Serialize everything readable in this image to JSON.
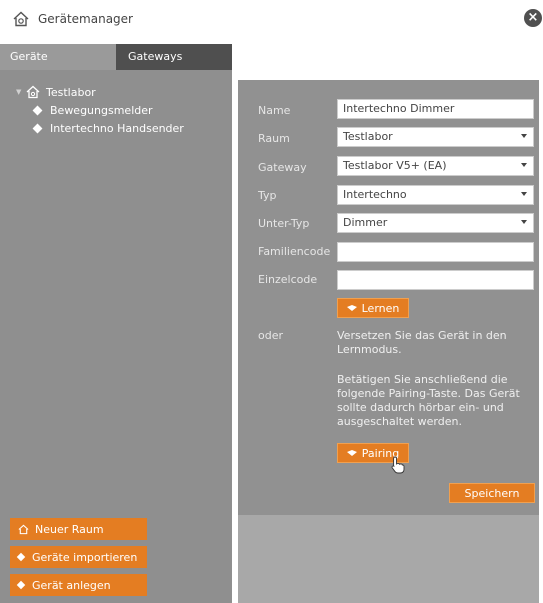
{
  "window": {
    "title": "Gerätemanager",
    "close_icon": "close-icon"
  },
  "tabs": [
    {
      "label": "Geräte"
    },
    {
      "label": "Gateways"
    }
  ],
  "tree": {
    "root": {
      "label": "Testlabor",
      "icon": "house-icon"
    },
    "children": [
      {
        "label": "Bewegungsmelder"
      },
      {
        "label": "Intertechno Handsender"
      }
    ]
  },
  "left_buttons": {
    "new_room": "Neuer Raum",
    "import_devices": "Geräte importieren",
    "create_device": "Gerät anlegen"
  },
  "form": {
    "name": {
      "label": "Name",
      "value": "Intertechno Dimmer"
    },
    "room": {
      "label": "Raum",
      "value": "Testlabor"
    },
    "gateway": {
      "label": "Gateway",
      "value": "Testlabor V5+ (EA)"
    },
    "type": {
      "label": "Typ",
      "value": "Intertechno"
    },
    "subtype": {
      "label": "Unter-Typ",
      "value": "Dimmer"
    },
    "family_code": {
      "label": "Familiencode",
      "value": ""
    },
    "single_code": {
      "label": "Einzelcode",
      "value": ""
    },
    "learn_button": "Lernen",
    "or_label": "oder",
    "learn_hint": "Versetzen Sie das Gerät in den Lernmodus.",
    "pairing_hint": "Betätigen Sie anschließend die folgende Pairing-Taste. Das Gerät sollte dadurch hörbar ein- und ausgeschaltet werden.",
    "pairing_button": "Pairing",
    "save_button": "Speichern"
  },
  "colors": {
    "accent": "#e47d22",
    "panel": "#8f8f8f",
    "active_tab": "#9a9a9a",
    "inactive_tab": "#4f4f4f"
  }
}
